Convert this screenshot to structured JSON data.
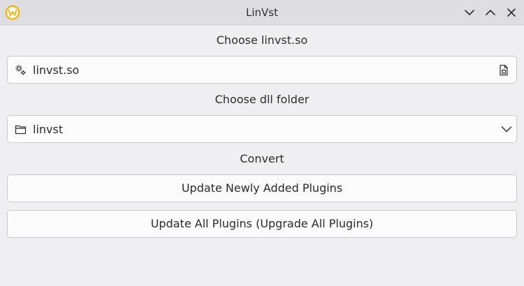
{
  "window": {
    "title": "LinVst",
    "app_icon": "w-logo-icon",
    "controls": [
      "chevron-down-icon",
      "chevron-up-icon",
      "close-icon"
    ]
  },
  "so_section": {
    "label": "Choose linvst.so",
    "value": "linvst.so",
    "leading_icon": "gears-icon",
    "trailing_icon": "file-open-icon"
  },
  "dll_section": {
    "label": "Choose dll folder",
    "value": "linvst",
    "leading_icon": "folder-icon",
    "trailing_icon": "chevron-down-icon"
  },
  "convert_section": {
    "label": "Convert",
    "buttons": {
      "update_new": "Update Newly Added Plugins",
      "update_all": "Update All Plugins (Upgrade All Plugins)"
    }
  },
  "colors": {
    "background": "#efeff1",
    "titlebar": "#dedee2",
    "field": "#fcfcfc",
    "border": "#c9c9cc",
    "app_icon": "#f4b51d"
  }
}
